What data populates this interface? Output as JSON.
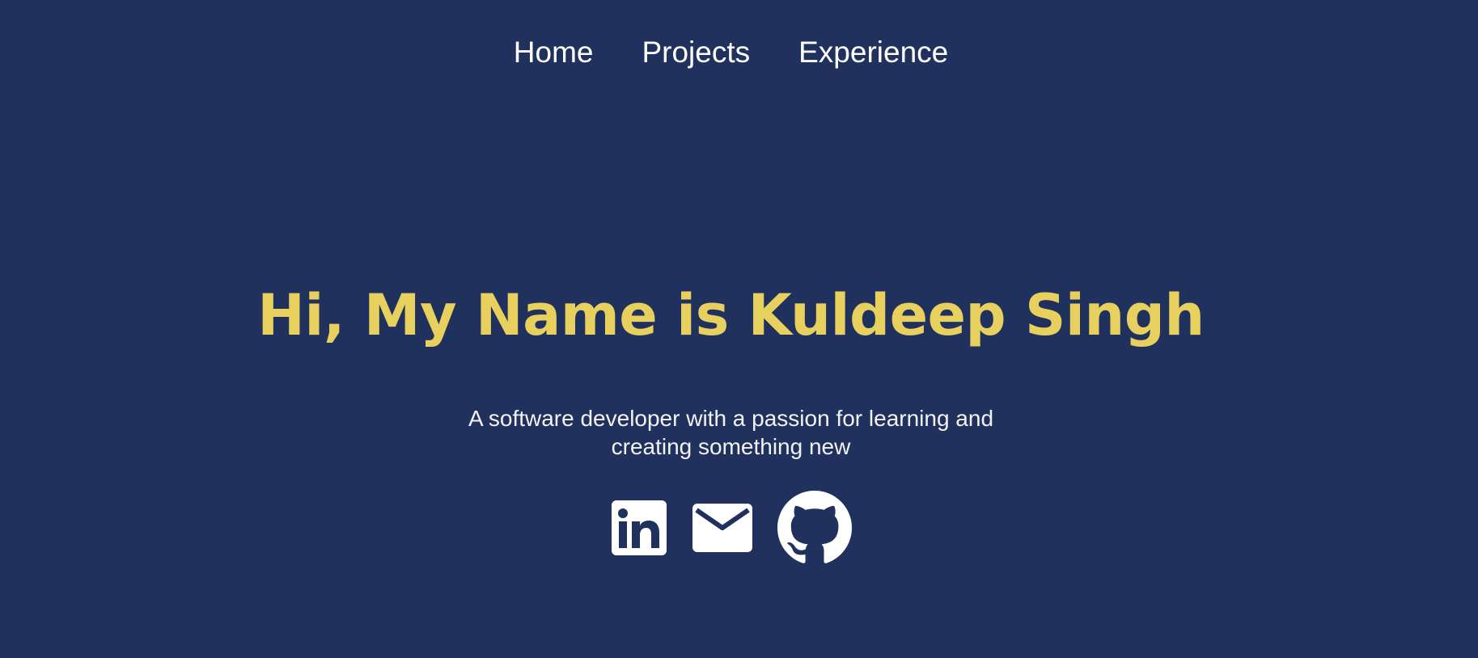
{
  "nav": {
    "items": [
      {
        "label": "Home"
      },
      {
        "label": "Projects"
      },
      {
        "label": "Experience"
      }
    ]
  },
  "hero": {
    "title": "Hi, My Name is Kuldeep Singh",
    "subtitle_line1": "A software developer with a passion for learning and",
    "subtitle_line2": "creating something new"
  },
  "social": {
    "icons": [
      "linkedin-icon",
      "mail-icon",
      "github-icon"
    ]
  },
  "colors": {
    "background": "#21315e",
    "accent": "#e8d05f",
    "text": "#ffffff"
  }
}
